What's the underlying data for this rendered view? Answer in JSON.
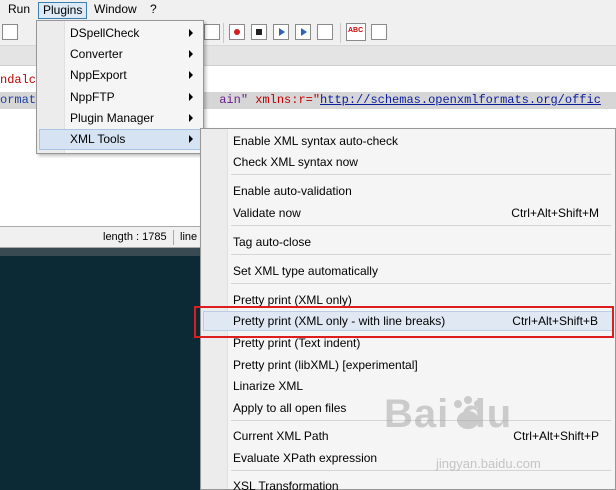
{
  "menubar": {
    "items": [
      {
        "label": "Run"
      },
      {
        "label": "Plugins"
      },
      {
        "label": "Window"
      },
      {
        "label": "?"
      }
    ]
  },
  "editor": {
    "line1": "ndalc",
    "line2_a": "ormats",
    "line2_b": "ain\"",
    "line2_c": " xmlns:r",
    "line2_d": "=\"",
    "line2_url": "http://schemas.openxmlformats.org/offic"
  },
  "status": {
    "length": "length : 1785",
    "line": "line"
  },
  "plugins_menu": {
    "items": [
      {
        "label": "DSpellCheck"
      },
      {
        "label": "Converter"
      },
      {
        "label": "NppExport"
      },
      {
        "label": "NppFTP"
      },
      {
        "label": "Plugin Manager"
      },
      {
        "label": "XML Tools"
      }
    ]
  },
  "xml_tools_menu": {
    "items": [
      {
        "label": "Enable XML syntax auto-check",
        "shortcut": ""
      },
      {
        "label": "Check XML syntax now",
        "shortcut": ""
      },
      {
        "label": "Enable auto-validation",
        "shortcut": ""
      },
      {
        "label": "Validate now",
        "shortcut": "Ctrl+Alt+Shift+M"
      },
      {
        "label": "Tag auto-close",
        "shortcut": ""
      },
      {
        "label": "Set XML type automatically",
        "shortcut": ""
      },
      {
        "label": "Pretty print (XML only)",
        "shortcut": ""
      },
      {
        "label": "Pretty print (XML only - with line breaks)",
        "shortcut": "Ctrl+Alt+Shift+B"
      },
      {
        "label": "Pretty print (Text indent)",
        "shortcut": ""
      },
      {
        "label": "Pretty print (libXML) [experimental]",
        "shortcut": ""
      },
      {
        "label": "Linarize XML",
        "shortcut": ""
      },
      {
        "label": "Apply to all open files",
        "shortcut": ""
      },
      {
        "label": "Current XML Path",
        "shortcut": "Ctrl+Alt+Shift+P"
      },
      {
        "label": "Evaluate XPath expression",
        "shortcut": ""
      },
      {
        "label": "XSL Transformation",
        "shortcut": ""
      }
    ]
  },
  "watermark": {
    "brand": "Bai du",
    "url": "jingyan.baidu.com"
  },
  "colors": {
    "highlight_box": "#dc1e1e",
    "console_bg": "#0c2a36",
    "menu_hover": "#dde9f5"
  }
}
